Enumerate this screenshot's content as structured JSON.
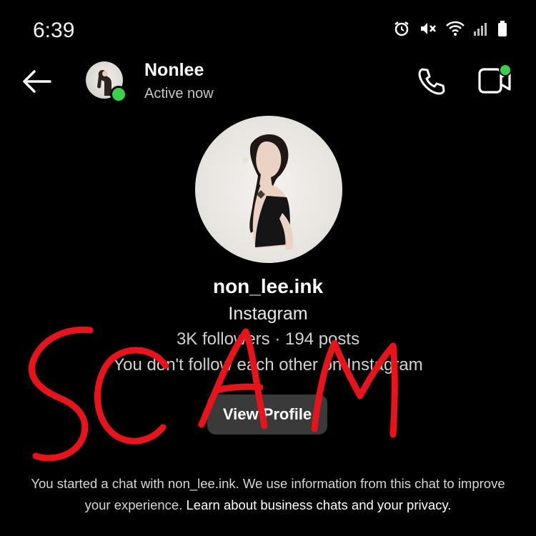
{
  "status_bar": {
    "time": "6:39",
    "icons": [
      "alarm-icon",
      "mute-icon",
      "wifi-icon",
      "signal-icon",
      "battery-icon"
    ]
  },
  "header": {
    "contact_name": "Nonlee",
    "contact_status": "Active now",
    "online": true,
    "icons": [
      "back-arrow-icon",
      "phone-icon",
      "video-icon"
    ]
  },
  "profile": {
    "username": "non_lee.ink",
    "platform": "Instagram",
    "stats": "3K followers · 194 posts",
    "follow_note": "You don't follow each other on Instagram",
    "view_profile_label": "View Profile"
  },
  "footer": {
    "text": "You started a chat with non_lee.ink. We use information from this chat to improve your experience.",
    "link": "Learn about business chats and your privacy."
  },
  "annotation": {
    "text": "SCAM"
  },
  "colors": {
    "background": "#000000",
    "online": "#3bd04a",
    "annotation": "#e8141b",
    "button": "#3a3a3a"
  }
}
